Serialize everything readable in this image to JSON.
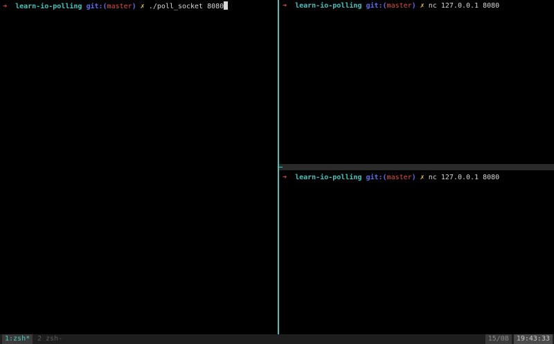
{
  "panes": {
    "left": {
      "arrow": "➜",
      "dir": "learn-io-polling",
      "git_prefix": "git:(",
      "branch": "master",
      "git_suffix": ")",
      "dirty": "✗",
      "command": "./poll_socket 8080"
    },
    "top_right": {
      "arrow": "➜",
      "dir": "learn-io-polling",
      "git_prefix": "git:(",
      "branch": "master",
      "git_suffix": ")",
      "dirty": "✗",
      "command": "nc 127.0.0.1 8080"
    },
    "bottom_right": {
      "arrow": "➜",
      "dir": "learn-io-polling",
      "git_prefix": "git:(",
      "branch": "master",
      "git_suffix": ")",
      "dirty": "✗",
      "command": "nc 127.0.0.1 8080"
    }
  },
  "status_bar": {
    "windows": [
      {
        "label": "1:zsh*",
        "active": true
      },
      {
        "label": "2 zsh-",
        "active": false
      }
    ],
    "date": "15/08",
    "time": "19:43:33"
  },
  "colors": {
    "background": "#000000",
    "pane_border_active": "#3fc7c0",
    "prompt_arrow": "#e0503a",
    "prompt_dir": "#3fc7c0",
    "prompt_git": "#5a6ff0",
    "prompt_branch": "#e0503a",
    "prompt_dirty": "#e8c33a"
  }
}
